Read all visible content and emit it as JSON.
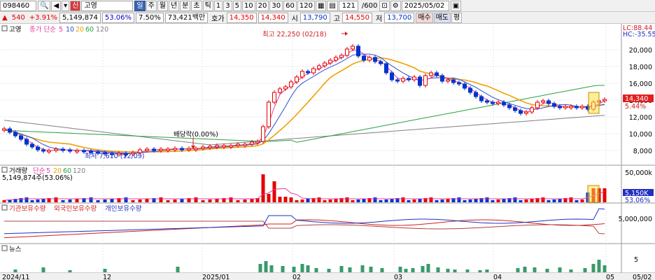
{
  "toolbar": {
    "code": "098460",
    "badge": "신",
    "name": "고영",
    "tab_day": "일",
    "periods": [
      "주",
      "월",
      "년",
      "분",
      "초",
      "틱"
    ],
    "intervals": [
      "1",
      "3",
      "5",
      "10",
      "20",
      "30",
      "60",
      "120"
    ],
    "count": "121",
    "count_max": "/600",
    "date": "2025/05/02"
  },
  "quote": {
    "change": "540",
    "change_pct": "+3.91%",
    "volume": "5,149,874",
    "vol_ratio": "53.06%",
    "turnover_pct": "7.50%",
    "amount": "73,421백만",
    "labels": {
      "hoga": "호가",
      "open": "시",
      "high": "고",
      "low": "저"
    },
    "ask": "14,350",
    "bid": "14,340",
    "open": "13,790",
    "high": "14,550",
    "low": "13,700",
    "buy": "매수",
    "sell": "매도",
    "eval": "평"
  },
  "price_pane": {
    "title": "고영",
    "ma_label": "종가 단순",
    "ma_periods": [
      "5",
      "10",
      "20",
      "60",
      "120"
    ],
    "lc": "LC:88.44",
    "hc": "HC:-35.55",
    "axis": [
      "20,000",
      "18,000",
      "16,000",
      "14,000",
      "12,000",
      "10,000",
      "8,000"
    ],
    "current_price": "14,340",
    "current_pct": "5.44%",
    "high_note": "최고 22,250 (02/18)",
    "low_note": "최저 7,610 (12/09)",
    "dividend_note": "배당락(0.00%)"
  },
  "volume_pane": {
    "title": "거래량",
    "ma_label": "단순",
    "ma_periods": [
      "5",
      "20",
      "60",
      "120"
    ],
    "value": "5,149,874주(53.06%)",
    "axis": "50,000k",
    "current": "5,150K",
    "current_pct": "53.06%"
  },
  "holdings_pane": {
    "legend": [
      "기관보유수량",
      "외국인보유수량",
      "개인보유수량"
    ],
    "axis": "5,000,000"
  },
  "news_pane": {
    "title": "뉴스",
    "axis": "5"
  },
  "x_axis": {
    "labels": [
      "2024/11",
      "12",
      "2025/01",
      "02",
      "03",
      "04",
      "05"
    ],
    "right": "05/02"
  },
  "colors": {
    "up": "#e60000",
    "down": "#0033cc",
    "ma5": "#e040a0",
    "ma10": "#3050d0",
    "ma20": "#f0a000",
    "ma60": "#2aa040",
    "ma120": "#808080",
    "news": "#3a9a6a"
  }
}
